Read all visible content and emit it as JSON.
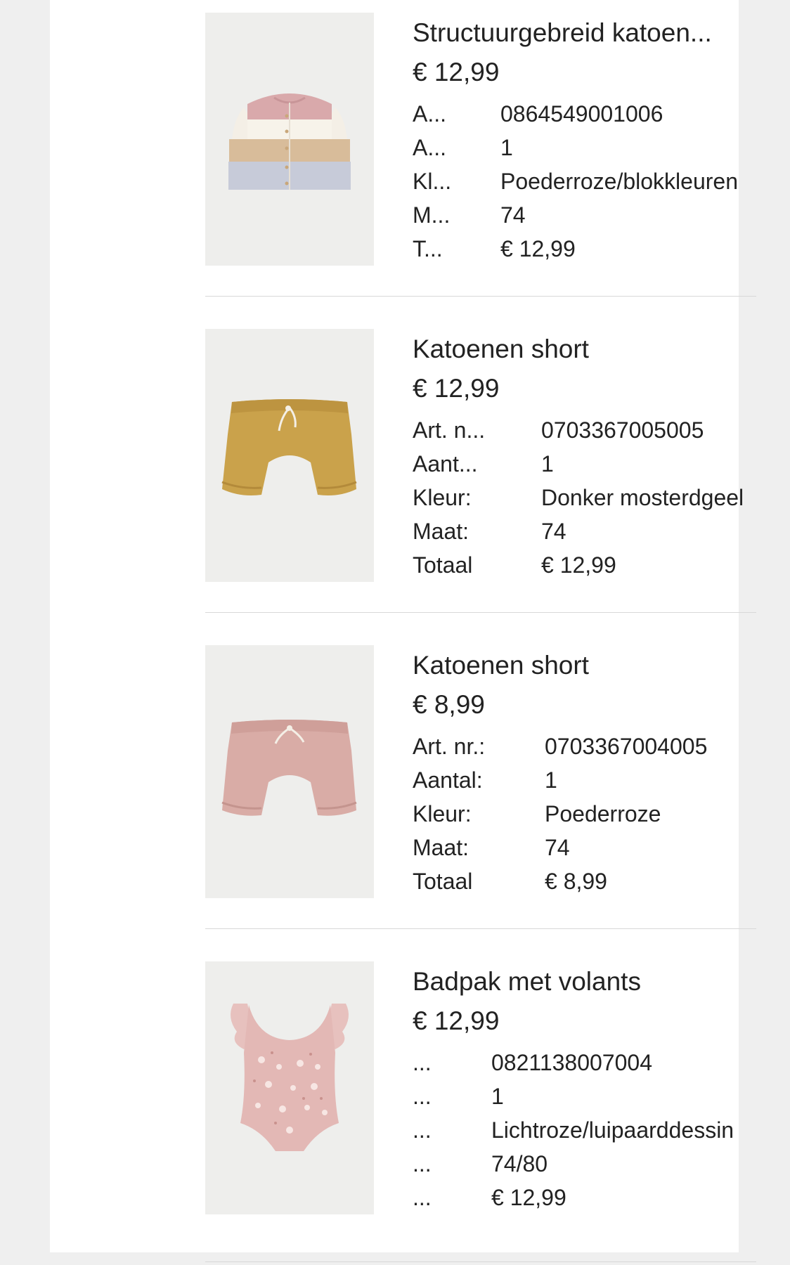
{
  "items": [
    {
      "name": "Structuurgebreid katoen...",
      "price": "€ 12,99",
      "rows": [
        {
          "label": "A...",
          "value": "0864549001006"
        },
        {
          "label": "A...",
          "value": "1"
        },
        {
          "label": "Kl...",
          "value": "Poederroze/blokkleuren"
        },
        {
          "label": "M...",
          "value": "74"
        },
        {
          "label": "T...",
          "value": "€ 12,99"
        }
      ],
      "image": "knit-cardigan-image",
      "colors": [
        "#d9a9ab",
        "#f7f3ea",
        "#d8bc9a",
        "#c7cbd9"
      ]
    },
    {
      "name": "Katoenen short",
      "price": "€ 12,99",
      "rows": [
        {
          "label": "Art. n...",
          "value": "0703367005005"
        },
        {
          "label": "Aant...",
          "value": "1"
        },
        {
          "label": "Kleur:",
          "value": "Donker mosterdgeel"
        },
        {
          "label": "Maat:",
          "value": "74"
        },
        {
          "label": "Totaal",
          "value": "€ 12,99"
        }
      ],
      "image": "mustard-shorts-image",
      "colors": [
        "#caa24b"
      ]
    },
    {
      "name": "Katoenen short",
      "price": "€ 8,99",
      "rows": [
        {
          "label": "Art. nr.:",
          "value": "0703367004005"
        },
        {
          "label": "Aantal:",
          "value": "1"
        },
        {
          "label": "Kleur:",
          "value": "Poederroze"
        },
        {
          "label": "Maat:",
          "value": "74"
        },
        {
          "label": "Totaal",
          "value": "€ 8,99"
        }
      ],
      "image": "pink-shorts-image",
      "colors": [
        "#d9aca6"
      ]
    },
    {
      "name": "Badpak met volants",
      "price": "€ 12,99",
      "rows": [
        {
          "label": "...",
          "value": "0821138007004"
        },
        {
          "label": "...",
          "value": "1"
        },
        {
          "label": "...",
          "value": "Lichtroze/luipaarddessin"
        },
        {
          "label": "...",
          "value": "74/80"
        },
        {
          "label": "...",
          "value": "€ 12,99"
        }
      ],
      "image": "swimsuit-image",
      "colors": [
        "#e3b8b5"
      ]
    }
  ]
}
